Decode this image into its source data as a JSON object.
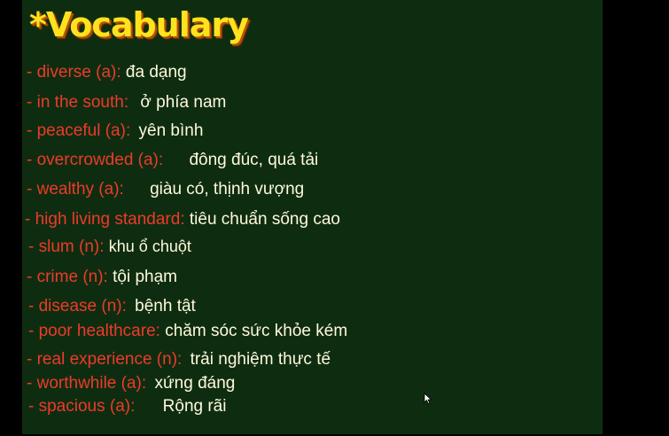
{
  "slide": {
    "title": "*Vocabulary",
    "colors": {
      "background": "#0e2d10",
      "frame": "#000000",
      "title": "#ffe21e",
      "term": "#ee3a2a",
      "meaning": "#fff8dc"
    },
    "items": [
      {
        "term": "- diverse  (a):",
        "meaning": "đa dạng"
      },
      {
        "term": "- in the south:",
        "meaning": "ở phía nam"
      },
      {
        "term": "- peaceful  (a):",
        "meaning": "yên bình"
      },
      {
        "term": "- overcrowded  (a):",
        "meaning": "đông đúc, quá tải"
      },
      {
        "term": "- wealthy  (a):",
        "meaning": "giàu có, thịnh vượng"
      },
      {
        "term": "- high living standard:",
        "meaning": "tiêu chuẩn sống cao"
      },
      {
        "term": "- slum  (n):",
        "meaning": "khu ổ chuột"
      },
      {
        "term": "- crime  (n):",
        "meaning": "tội phạm"
      },
      {
        "term": "- disease  (n):",
        "meaning": "bệnh tật"
      },
      {
        "term": "- poor healthcare:",
        "meaning": "chăm sóc sức khỏe kém"
      },
      {
        "term": "- real experience  (n):",
        "meaning": "trải nghiệm thực tế"
      },
      {
        "term": "- worthwhile  (a):",
        "meaning": "xứng đáng"
      },
      {
        "term": "- spacious  (a):",
        "meaning": "Rộng rãi"
      }
    ]
  },
  "pointer": {
    "icon": "mouse-pointer-icon"
  }
}
